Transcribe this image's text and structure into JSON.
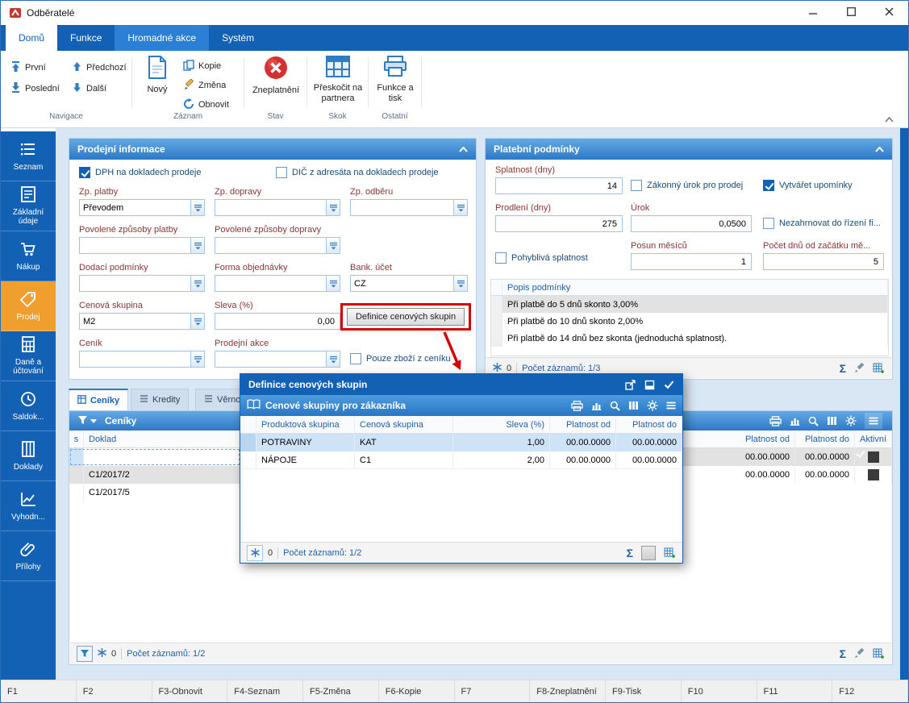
{
  "window": {
    "title": "Odběratelé"
  },
  "icons": {
    "sum": "Σ"
  },
  "ribbon": {
    "tabs": [
      {
        "label": "Domů"
      },
      {
        "label": "Funkce"
      },
      {
        "label": "Hromadné akce"
      },
      {
        "label": "Systém"
      }
    ],
    "groups": {
      "navigace": {
        "label": "Navigace",
        "first": "První",
        "last": "Poslední",
        "prev": "Předchozí",
        "next": "Další"
      },
      "zaznam": {
        "label": "Záznam",
        "new": "Nový",
        "copy": "Kopie",
        "change": "Změna",
        "refresh": "Obnovit"
      },
      "stav": {
        "label": "Stav",
        "invalidate": "Zneplatnění"
      },
      "skok": {
        "label": "Skok",
        "jump": "Přeskočit na partnera"
      },
      "ostatni": {
        "label": "Ostatní",
        "print": "Funkce a tisk"
      }
    }
  },
  "sidebar": {
    "items": [
      {
        "label": "Seznam"
      },
      {
        "label": "Základní údaje"
      },
      {
        "label": "Nákup"
      },
      {
        "label": "Prodej"
      },
      {
        "label": "Daně a účtování"
      },
      {
        "label": "Saldok..."
      },
      {
        "label": "Doklady"
      },
      {
        "label": "Vyhodn..."
      },
      {
        "label": "Přílohy"
      }
    ]
  },
  "sales": {
    "title": "Prodejní informace",
    "cb": {
      "dph": {
        "label": "DPH na dokladech prodeje",
        "checked": true
      },
      "dic": {
        "label": "DIČ z adresáta na dokladech prodeje",
        "checked": false
      },
      "pouze": {
        "label": "Pouze zboží z ceníku",
        "checked": false
      }
    },
    "fields": {
      "zp_platby": {
        "label": "Zp. platby",
        "value": "Převodem"
      },
      "zp_dopravy": {
        "label": "Zp. dopravy",
        "value": ""
      },
      "zp_odberu": {
        "label": "Zp. odběru",
        "value": ""
      },
      "pov_platby": {
        "label": "Povolené způsoby platby",
        "value": ""
      },
      "pov_dopravy": {
        "label": "Povolené způsoby dopravy",
        "value": ""
      },
      "dodaci": {
        "label": "Dodací podmínky",
        "value": ""
      },
      "forma": {
        "label": "Forma objednávky",
        "value": ""
      },
      "bank": {
        "label": "Bank. účet",
        "value": "CZ"
      },
      "cen_skupina": {
        "label": "Cenová skupina",
        "value": "M2"
      },
      "sleva": {
        "label": "Sleva (%)",
        "value": "0,00"
      },
      "cenik": {
        "label": "Ceník",
        "value": ""
      },
      "akce": {
        "label": "Prodejní akce",
        "value": ""
      }
    },
    "definice_button": "Definice cenových skupin"
  },
  "payment": {
    "title": "Platební podmínky",
    "fields": {
      "splatnost": {
        "label": "Splatnost (dny)",
        "value": "14"
      },
      "prodleni": {
        "label": "Prodlení (dny)",
        "value": "275"
      },
      "urok": {
        "label": "Úrok",
        "value": "0,0500"
      },
      "posun": {
        "label": "Posun měsíců",
        "value": "1"
      },
      "pocet_dnu": {
        "label": "Počet dnů od začátku mě...",
        "value": "5"
      }
    },
    "cb": {
      "zakonny": {
        "label": "Zákonný úrok pro prodej",
        "checked": false
      },
      "upominky": {
        "label": "Vytvářet upomínky",
        "checked": true
      },
      "nezahrnovat": {
        "label": "Nezahrnovat do řízení fi...",
        "checked": false
      },
      "pohybliva": {
        "label": "Pohyblivá splatnost",
        "checked": false
      }
    },
    "table": {
      "header": "Popis podmínky",
      "rows": [
        "Při platbě do 5 dnů skonto 3,00%",
        "Při platbě do 10 dnů skonto 2,00%",
        "Při platbě do 14 dnů bez skonta (jednoduchá splatnost)."
      ]
    },
    "footer": {
      "frozen": "0",
      "records": "Počet záznamů: 1/3"
    }
  },
  "lower": {
    "tabs": [
      {
        "label": "Ceníky"
      },
      {
        "label": "Kredity"
      },
      {
        "label": "Věrnostní pr"
      }
    ],
    "title": "Ceníky",
    "left": {
      "col_s": "s",
      "col_doklad": "Doklad",
      "rows": [
        "",
        "C1/2017/2",
        "C1/2017/5"
      ]
    },
    "right": {
      "col_od": "Platnost od",
      "col_do": "Platnost do",
      "col_akt": "Aktivní",
      "rows": [
        {
          "od": "00.00.0000",
          "do": "00.00.0000",
          "aktivni": true
        },
        {
          "od": "00.00.0000",
          "do": "00.00.0000",
          "aktivni": true
        }
      ]
    },
    "footer": {
      "frozen": "0",
      "records": "Počet záznamů: 1/2"
    }
  },
  "popup": {
    "title": "Definice cenových skupin",
    "subtitle": "Cenové skupiny pro zákazníka",
    "cols": [
      "Produktová skupina",
      "Cenová skupina",
      "Sleva (%)",
      "Platnost od",
      "Platnost do"
    ],
    "rows": [
      [
        "POTRAVINY",
        "KAT",
        "1,00",
        "00.00.0000",
        "00.00.0000"
      ],
      [
        "NÁPOJE",
        "C1",
        "2,00",
        "00.00.0000",
        "00.00.0000"
      ]
    ],
    "footer": {
      "frozen": "0",
      "records": "Počet záznamů: 1/2"
    }
  },
  "statusbar": {
    "keys": [
      "F1",
      "F2",
      "F3-Obnovit",
      "F4-Seznam",
      "F5-Změna",
      "F6-Kopie",
      "F7",
      "F8-Zneplatnění",
      "F9-Tisk",
      "F10",
      "F11",
      "F12"
    ]
  }
}
